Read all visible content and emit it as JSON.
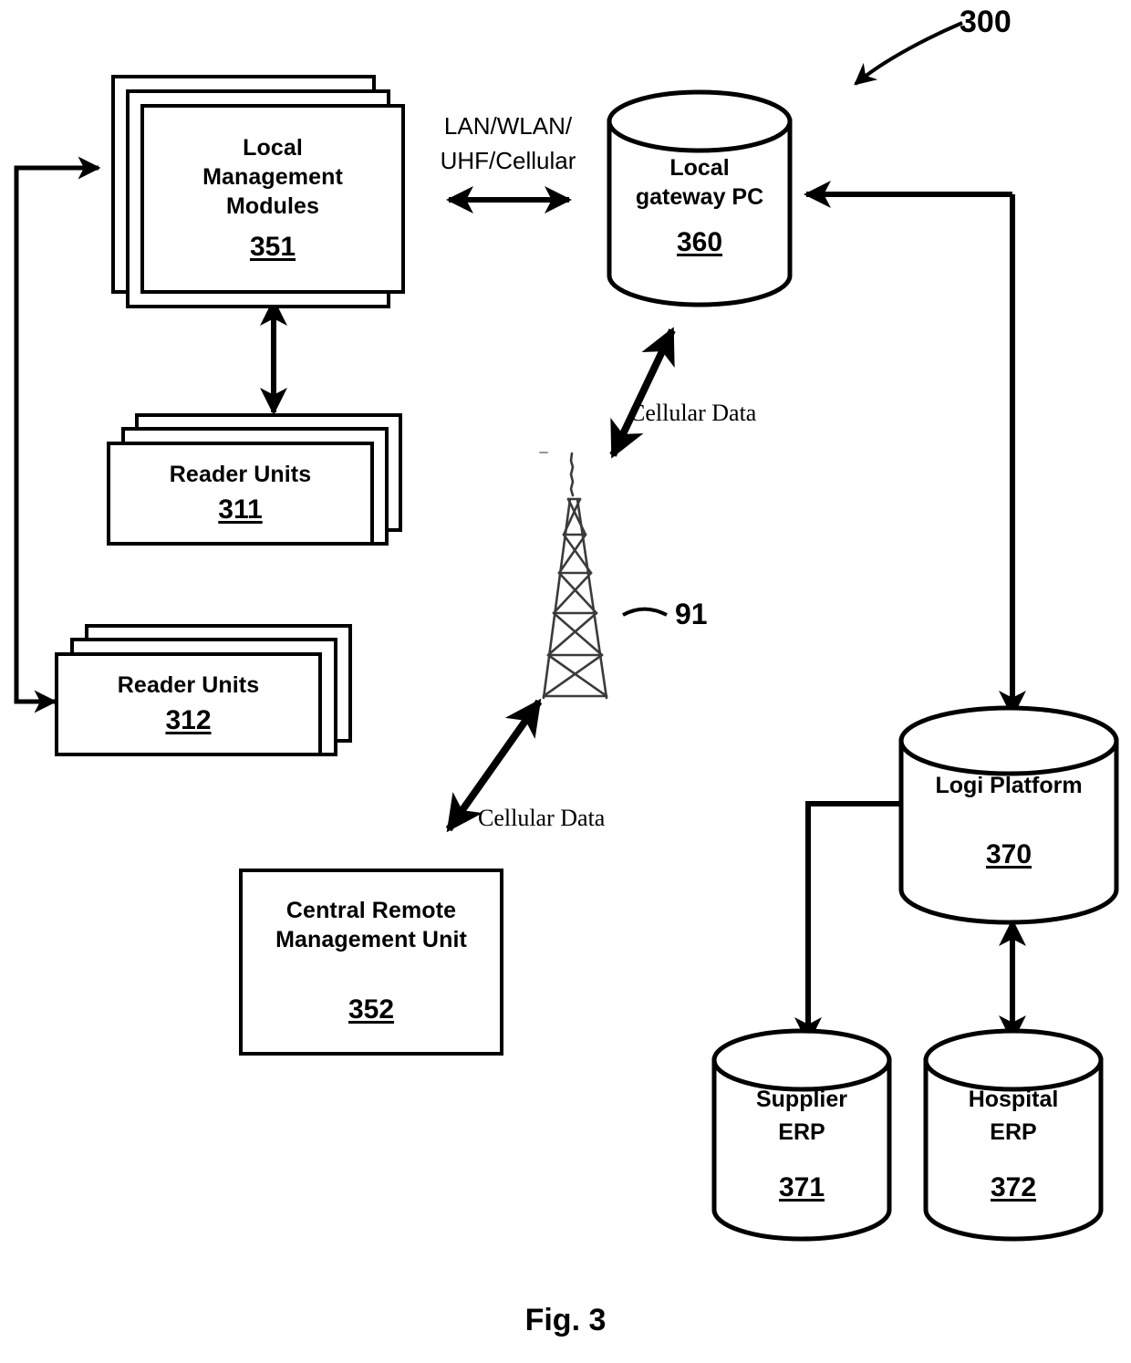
{
  "figure": {
    "caption": "Fig. 3",
    "system_ref": "300"
  },
  "nodes": {
    "local_management_modules": {
      "label": "Local\nManagement\nModules",
      "ref": "351",
      "shape": "stacked-box"
    },
    "reader_units_311": {
      "label": "Reader Units",
      "ref": "311",
      "shape": "stacked-box"
    },
    "reader_units_312": {
      "label": "Reader Units",
      "ref": "312",
      "shape": "stacked-box"
    },
    "central_remote_management_unit": {
      "label": "Central Remote\nManagement Unit",
      "ref": "352",
      "shape": "box"
    },
    "local_gateway_pc": {
      "label": "Local\ngateway PC",
      "ref": "360",
      "shape": "cylinder"
    },
    "logi_platform": {
      "label": "Logi Platform",
      "ref": "370",
      "shape": "cylinder"
    },
    "supplier_erp": {
      "label": "Supplier\nERP",
      "ref": "371",
      "shape": "cylinder"
    },
    "hospital_erp": {
      "label": "Hospital\nERP",
      "ref": "372",
      "shape": "cylinder"
    },
    "cell_tower": {
      "ref": "91",
      "shape": "cell-tower"
    }
  },
  "annotations": {
    "lan_wlan": "LAN/WLAN/\nUHF/Cellular",
    "cellular_data_upper": "Cellular Data",
    "cellular_data_lower": "Cellular Data"
  },
  "colors": {
    "stroke": "#000000",
    "fill": "#ffffff",
    "tower": "#1a1a1a"
  }
}
